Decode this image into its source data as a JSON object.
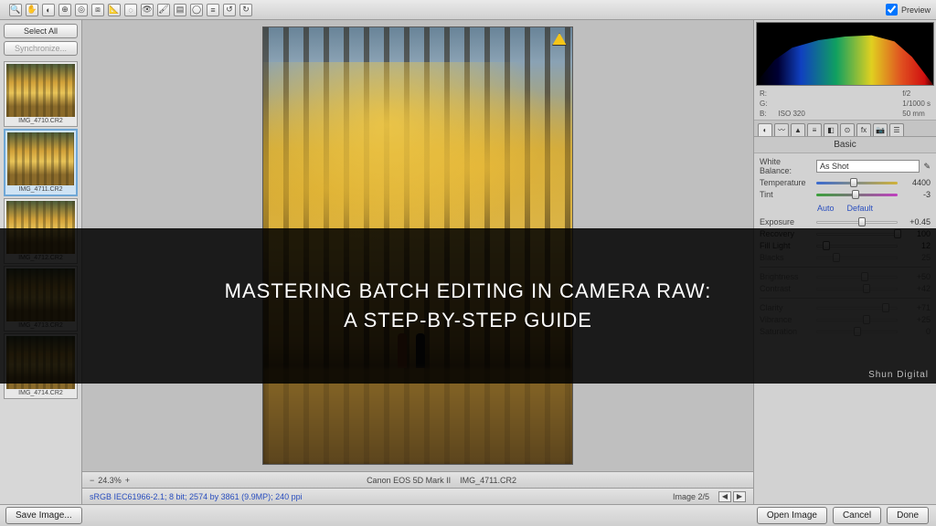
{
  "toolbar": {
    "preview_label": "Preview",
    "preview_checked": true
  },
  "filmstrip": {
    "select_all": "Select All",
    "synchronize": "Synchronize...",
    "thumbs": [
      {
        "label": "IMG_4710.CR2"
      },
      {
        "label": "IMG_4711.CR2"
      },
      {
        "label": "IMG_4712.CR2"
      },
      {
        "label": "IMG_4713.CR2"
      },
      {
        "label": "IMG_4714.CR2"
      }
    ],
    "selected_index": 1
  },
  "canvas": {
    "zoom": "24.3%",
    "camera": "Canon EOS 5D Mark II",
    "filename": "IMG_4711.CR2"
  },
  "status": {
    "profile": "sRGB IEC61966-2.1; 8 bit; 2574 by 3861 (9.9MP); 240 ppi",
    "image_index": "Image 2/5"
  },
  "info": {
    "r": "R:",
    "g": "G:",
    "b": "B:",
    "aperture": "f/2",
    "shutter": "1/1000 s",
    "iso": "ISO 320",
    "focal": "50 mm"
  },
  "panel": {
    "title": "Basic",
    "wb_label": "White Balance:",
    "wb_value": "As Shot",
    "auto": "Auto",
    "default": "Default",
    "sliders": {
      "temperature": {
        "label": "Temperature",
        "value": "4400",
        "pos": 46
      },
      "tint": {
        "label": "Tint",
        "value": "-3",
        "pos": 48
      },
      "exposure": {
        "label": "Exposure",
        "value": "+0.45",
        "pos": 56
      },
      "recovery": {
        "label": "Recovery",
        "value": "100",
        "pos": 100
      },
      "fill": {
        "label": "Fill Light",
        "value": "12",
        "pos": 12
      },
      "blacks": {
        "label": "Blacks",
        "value": "25",
        "pos": 25
      },
      "brightness": {
        "label": "Brightness",
        "value": "+50",
        "pos": 60
      },
      "contrast": {
        "label": "Contrast",
        "value": "+42",
        "pos": 62
      },
      "clarity": {
        "label": "Clarity",
        "value": "+71",
        "pos": 85
      },
      "vibrance": {
        "label": "Vibrance",
        "value": "+25",
        "pos": 62
      },
      "saturation": {
        "label": "Saturation",
        "value": "0",
        "pos": 50
      }
    }
  },
  "buttons": {
    "save": "Save Image...",
    "open": "Open Image",
    "cancel": "Cancel",
    "done": "Done"
  },
  "overlay": {
    "line1": "MASTERING BATCH EDITING IN CAMERA RAW:",
    "line2": "A STEP-BY-STEP GUIDE",
    "watermark": "Shun Digital"
  }
}
